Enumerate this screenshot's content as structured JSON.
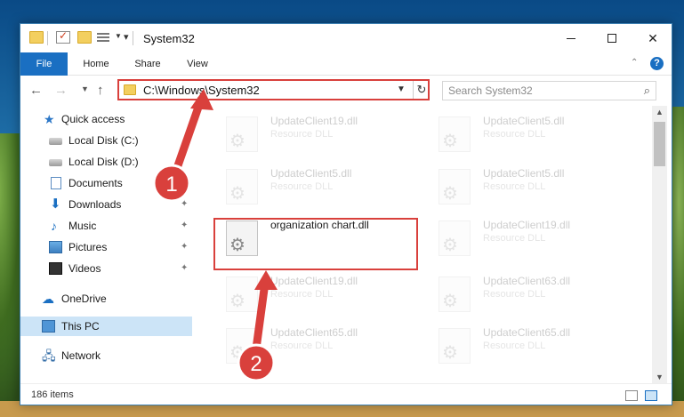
{
  "window": {
    "title": "System32",
    "minimize": "—",
    "close": "✕"
  },
  "ribbon": {
    "tabs": [
      "File",
      "Home",
      "Share",
      "View"
    ],
    "help": "?"
  },
  "address_bar": {
    "path": "C:\\Windows\\System32",
    "refresh": "↻",
    "dropdown": "⌄"
  },
  "search": {
    "placeholder": "Search System32",
    "icon": "⚲"
  },
  "nav": {
    "back": "←",
    "forward": "→",
    "recent": "⌄",
    "up": "↑"
  },
  "sidebar": {
    "items": [
      {
        "label": "Quick access",
        "icon": "star-icon",
        "pinned": false
      },
      {
        "label": "Local Disk (C:)",
        "icon": "disk-icon",
        "pinned": false
      },
      {
        "label": "Local Disk (D:)",
        "icon": "disk-icon",
        "pinned": true
      },
      {
        "label": "Documents",
        "icon": "documents-icon",
        "pinned": false
      },
      {
        "label": "Downloads",
        "icon": "download-icon",
        "pinned": true
      },
      {
        "label": "Music",
        "icon": "music-icon",
        "pinned": true
      },
      {
        "label": "Pictures",
        "icon": "pictures-icon",
        "pinned": true
      },
      {
        "label": "Videos",
        "icon": "videos-icon",
        "pinned": true
      },
      {
        "label": "OneDrive",
        "icon": "cloud-icon",
        "pinned": false
      },
      {
        "label": "This PC",
        "icon": "computer-icon",
        "pinned": false,
        "selected": true
      },
      {
        "label": "Network",
        "icon": "network-icon",
        "pinned": false
      }
    ],
    "pin_glyph": "📌"
  },
  "files": [
    {
      "name": "UpdateClient19.dll",
      "type": "Resource DLL"
    },
    {
      "name": "UpdateClient5.dll",
      "type": "Resource DLL"
    },
    {
      "name": "UpdateClient5.dll",
      "type": "Resource DLL"
    },
    {
      "name": "UpdateClient5.dll",
      "type": "Resource DLL"
    },
    {
      "name": "organization chart.dll",
      "type": ""
    },
    {
      "name": "UpdateClient19.dll",
      "type": "Resource DLL"
    },
    {
      "name": "UpdateClient19.dll",
      "type": "Resource DLL"
    },
    {
      "name": "UpdateClient63.dll",
      "type": "Resource DLL"
    },
    {
      "name": "UpdateClient65.dll",
      "type": "Resource DLL"
    },
    {
      "name": "UpdateClient65.dll",
      "type": "Resource DLL"
    }
  ],
  "status": {
    "item_count": "186 items"
  },
  "annotations": {
    "step1": "1",
    "step2": "2",
    "color": "#d9403c"
  }
}
